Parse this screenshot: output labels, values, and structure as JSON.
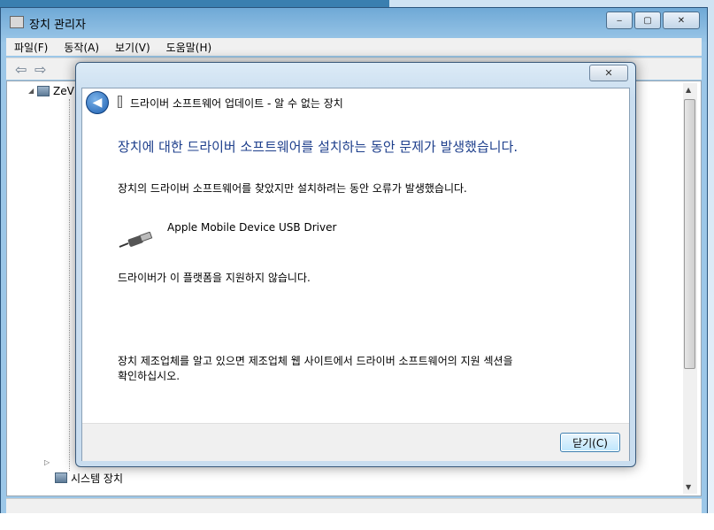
{
  "device_manager": {
    "title": "장치 관리자",
    "menu": [
      "파일(F)",
      "동작(A)",
      "보기(V)",
      "도움말(H)"
    ],
    "tree_root": "ZeV",
    "tree_bottom_items": [
      "시스템 장치"
    ],
    "window_controls": [
      "‒",
      "▢",
      "✕"
    ]
  },
  "dialog": {
    "title": "드라이버 소프트웨어 업데이트 - 알 수 없는 장치",
    "heading": "장치에 대한 드라이버 소프트웨어를 설치하는 동안 문제가 발생했습니다.",
    "line1": "장치의 드라이버 소프트웨어를 찾았지만 설치하려는 동안 오류가 발생했습니다.",
    "driver_name": "Apple Mobile Device USB Driver",
    "line2": "드라이버가 이 플랫폼을 지원하지 않습니다.",
    "line3a": "장치 제조업체를 알고 있으면 제조업체 웹 사이트에서 드라이버 소프트웨어의 지원 섹션을",
    "line3b": "확인하십시오.",
    "close_label": "닫기(C)",
    "x_label": "✕",
    "back_label": "◀"
  },
  "colors": {
    "heading": "#1e3f8c",
    "window_frame": "#9cc7e8"
  }
}
